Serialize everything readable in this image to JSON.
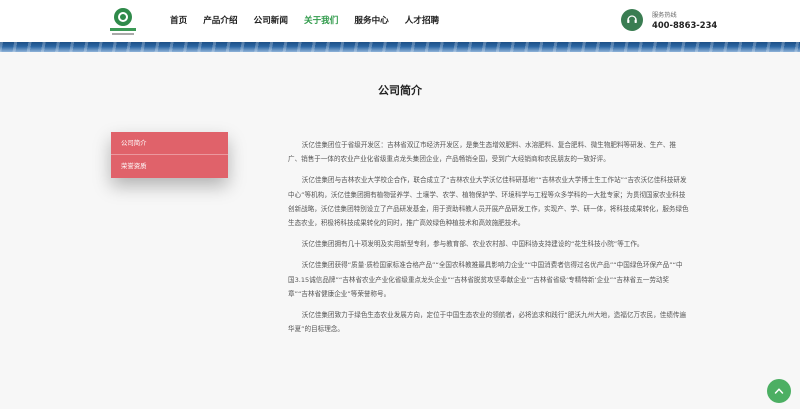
{
  "header": {
    "nav": [
      "首页",
      "产品介绍",
      "公司新闻",
      "关于我们",
      "服务中心",
      "人才招聘"
    ],
    "active_nav": "关于我们",
    "hotline_label": "服务热线",
    "hotline_number": "400-8863-234"
  },
  "main": {
    "title": "公司简介",
    "side_menu": [
      "公司简介",
      "荣誉资质"
    ],
    "paragraphs": [
      "沃亿佳集团位于省级开发区：吉林省双辽市经济开发区，是集生态增效肥料、水溶肥料、复合肥料、微生物肥料等研发、生产、推广、销售于一体的农业产业化省级重点龙头集团企业，产品畅销全国，受到广大经销商和农民朋友的一致好评。",
      "沃亿佳集团与吉林农业大学校企合作，联合成立了“吉林农业大学沃亿佳科研基地”“吉林农业大学博士生工作站”“吉农沃亿佳科技研发中心”等机构，沃亿佳集团拥有植物营养学、土壤学、农学、植物保护学、环境科学与工程等众多学科的一大批专家；为贯彻国家农业科技创新战略，沃亿佳集团特别设立了产品研发基金，用于资助科教人员开展产品研发工作，实现产、学、研一体，将科技成果转化，服务绿色生态农业，积极将科技成果转化的同时，推广高效绿色种植技术和高效施肥技术。",
      "沃亿佳集团拥有几十项发明及实用新型专利，参与教育部、农业农村部、中国科协支持建设的“花生科技小院”等工作。",
      "沃亿佳集团获得“质量·质检国家标准合格产品”“全国农科教推最具影响力企业”“中国消费者信得过名优产品”“中国绿色环保产品”“中国3.15诚信品牌”“吉林省农业产业化省级重点龙头企业”“吉林省脱贫攻坚奉献企业”“吉林省省级‘专精特新’企业”“吉林省五一劳动奖章”“吉林省健康企业”等荣誉称号。",
      "沃亿佳集团致力于绿色生态农业发展方向，定位于中国生态农业的领航者，必将追求和践行“肥沃九州大地，造福亿万农民，佳绩传遍华夏”的目标理念。"
    ]
  },
  "icons": {
    "logo": "company-logo",
    "hotline": "phone-icon",
    "to_top": "chevron-up-icon"
  },
  "colors": {
    "accent_green": "#2f9a4a",
    "menu_red": "#e0626a",
    "banner_blue": "#2b66a3"
  }
}
